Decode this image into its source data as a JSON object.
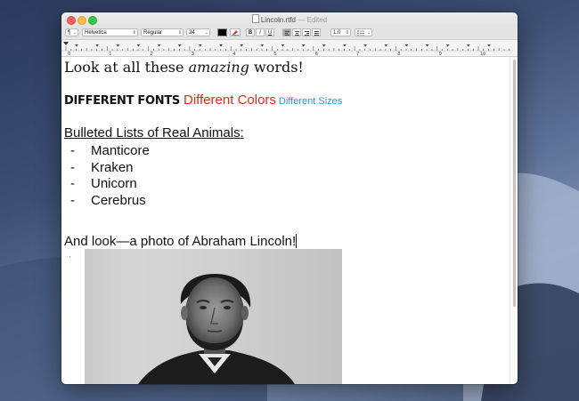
{
  "window": {
    "title": "Lincoln.rtfd",
    "title_status": "— Edited"
  },
  "toolbar": {
    "paragraph_style": "¶",
    "font_family": "Helvetica",
    "font_style": "Regular",
    "font_size": "24",
    "text_color": "#000000",
    "bold_label": "B",
    "italic_label": "I",
    "underline_label": "U",
    "line_spacing": "1.0",
    "alignment_active": "left"
  },
  "ruler": {
    "ticks": [
      "0",
      "1",
      "2",
      "3",
      "4",
      "5",
      "6",
      "7",
      "8",
      "9",
      "10"
    ]
  },
  "document": {
    "line1_before": "Look at all these ",
    "line1_emphasis": "amazing",
    "line1_after": " words!",
    "fonts_text": "DIFFERENT FONTS",
    "colors_text": "Different Colors",
    "sizes_text": "Different Sizes",
    "list_heading": "Bulleted Lists of Real Animals:",
    "list_marker": "-",
    "list_items": [
      "Manticore",
      "Kraken",
      "Unicorn",
      "Cerebrus"
    ],
    "photo_line": "And look—a photo of Abraham Lincoln!",
    "colors": {
      "red": "#e8251d",
      "blue": "#1d9bd6"
    }
  }
}
